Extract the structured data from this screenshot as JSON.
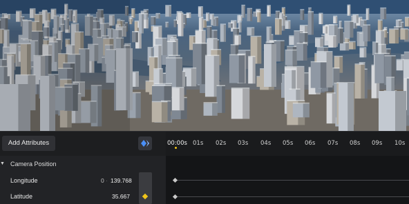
{
  "toolbar": {
    "add_attributes_label": "Add Attributes",
    "keyframe_icon": "keyframe-diamond-icon",
    "accent_color": "#4a8ff7"
  },
  "timeline": {
    "ticks": [
      "00:00s",
      "01s",
      "02s",
      "03s",
      "04s",
      "05s",
      "06s",
      "07s",
      "08s",
      "09s",
      "10s"
    ],
    "playhead_color": "#f0c419"
  },
  "panel": {
    "section_title": "Camera Position",
    "properties": [
      {
        "label": "Longitude",
        "prefix": "0",
        "value": "139.768"
      },
      {
        "label": "Latitude",
        "prefix": "",
        "value": "35.667"
      }
    ],
    "key_active_color": "#f0c419"
  }
}
